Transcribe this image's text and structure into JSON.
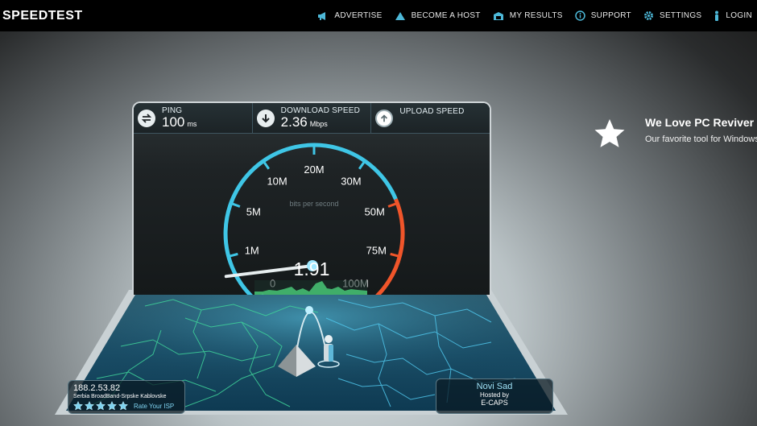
{
  "app": {
    "logo": "SPEEDTEST"
  },
  "nav": [
    {
      "label": "ADVERTISE",
      "icon": "megaphone-icon"
    },
    {
      "label": "BECOME A HOST",
      "icon": "host-icon"
    },
    {
      "label": "MY RESULTS",
      "icon": "results-icon"
    },
    {
      "label": "SUPPORT",
      "icon": "info-icon"
    },
    {
      "label": "SETTINGS",
      "icon": "gear-icon"
    },
    {
      "label": "LOGIN",
      "icon": "user-icon"
    }
  ],
  "stats": {
    "ping": {
      "label": "PING",
      "value": "100",
      "unit": "ms"
    },
    "download": {
      "label": "DOWNLOAD SPEED",
      "value": "2.36",
      "unit": "Mbps"
    },
    "upload": {
      "label": "UPLOAD SPEED",
      "value": "",
      "unit": ""
    }
  },
  "gauge": {
    "ticks": [
      "0",
      "1M",
      "5M",
      "10M",
      "20M",
      "30M",
      "50M",
      "75M",
      "100M"
    ],
    "unit_label": "bits per second",
    "current": "1.91",
    "current_value_mbps": 1.91,
    "accent": "#3fc6e6",
    "danger": "#f0552a"
  },
  "client": {
    "ip": "188.2.53.82",
    "isp": "Serbia BroadBand-Srpske Kablovske",
    "rate_label": "Rate Your ISP",
    "stars": 5
  },
  "server": {
    "city": "Novi Sad",
    "hosted_label": "Hosted by",
    "sponsor": "E-CAPS"
  },
  "ad": {
    "title": "We Love PC Reviver",
    "text": "Our favorite tool for Windows and maintenance",
    "icon": "star-icon"
  }
}
